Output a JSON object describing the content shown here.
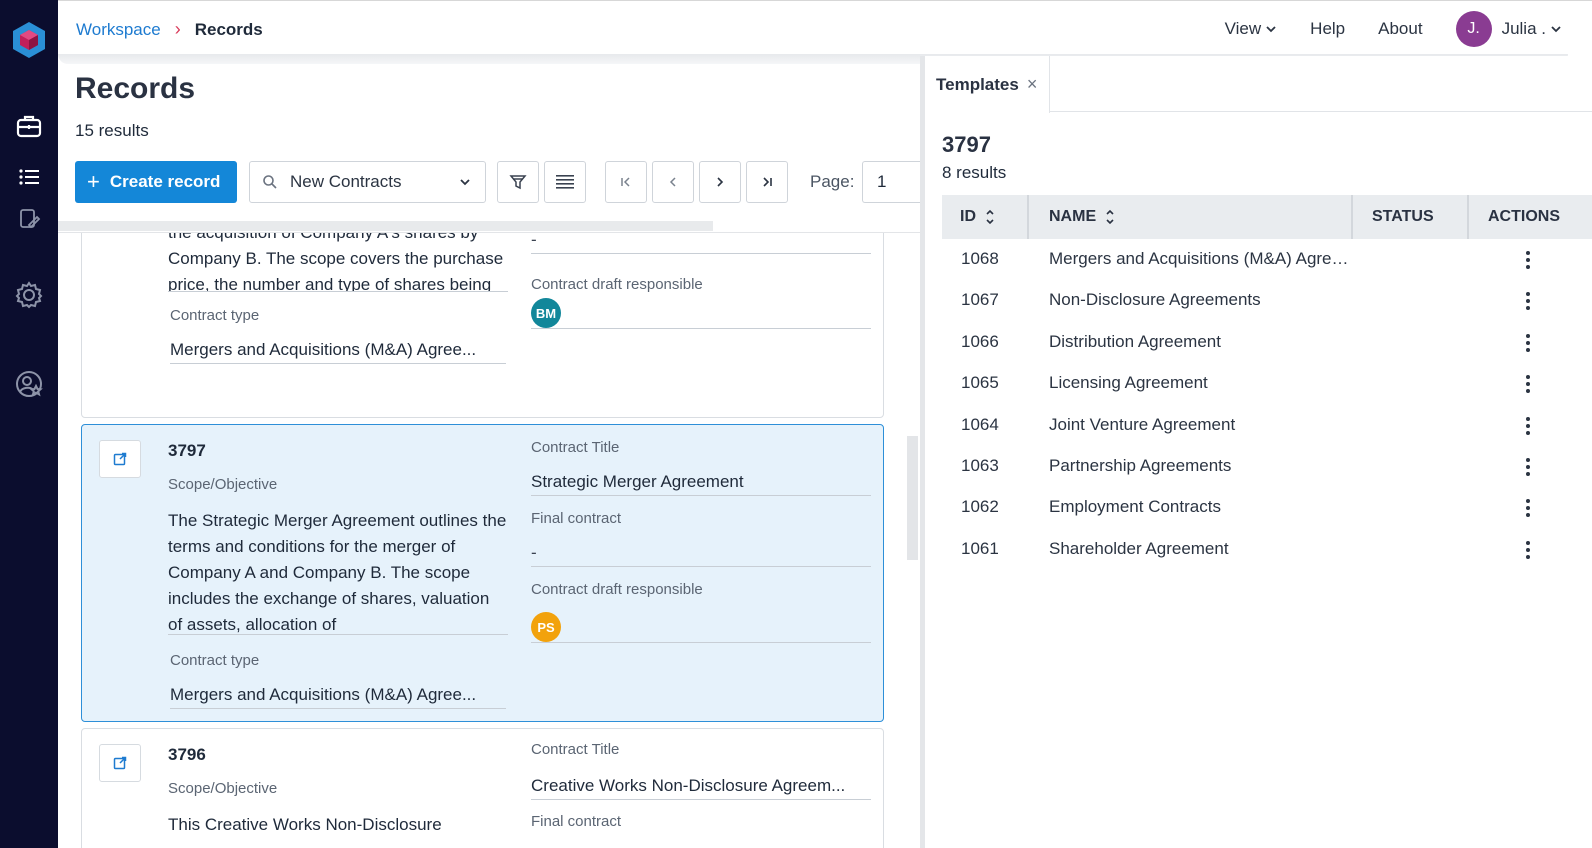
{
  "breadcrumb": {
    "root": "Workspace",
    "separator": "›",
    "current": "Records"
  },
  "topnav": {
    "view": "View",
    "help": "Help",
    "about": "About",
    "user_initial": "J.",
    "user_name": "Julia ."
  },
  "page": {
    "title": "Records",
    "results": "15 results"
  },
  "toolbar": {
    "create_label": "Create record",
    "create_plus": "+",
    "filter_value": "New Contracts",
    "page_label": "Page:",
    "page_value": "1"
  },
  "cards": [
    {
      "scope_text": "the acquisition of Company A's shares by Company B. The scope covers the purchase price, the number and type of shares being acquired, representations",
      "contract_type_label": "Contract type",
      "contract_type": "Mergers and Acquisitions (M&A) Agree...",
      "final_value": "-",
      "responsible_label": "Contract draft responsible",
      "responsible_initials": "BM"
    },
    {
      "id": "3797",
      "scope_label": "Scope/Objective",
      "scope_text": "The Strategic Merger Agreement outlines the terms and conditions for the merger of Company A and Company B. The scope includes the exchange of shares, valuation of assets, allocation of",
      "contract_type_label": "Contract type",
      "contract_type": "Mergers and Acquisitions (M&A) Agree...",
      "title_label": "Contract Title",
      "title_value": "Strategic Merger Agreement",
      "final_label": "Final contract",
      "final_value": "-",
      "responsible_label": "Contract draft responsible",
      "responsible_initials": "PS"
    },
    {
      "id": "3796",
      "scope_label": "Scope/Objective",
      "scope_text": "This Creative Works Non-Disclosure",
      "title_label": "Contract Title",
      "title_value": "Creative Works Non-Disclosure Agreem...",
      "final_label": "Final contract"
    }
  ],
  "templates": {
    "tab_label": "Templates",
    "close": "×",
    "heading": "3797",
    "results": "8 results",
    "columns": [
      "ID",
      "NAME",
      "STATUS",
      "ACTIONS"
    ],
    "rows": [
      {
        "id": "1068",
        "name": "Mergers and Acquisitions (M&A) Agree..."
      },
      {
        "id": "1067",
        "name": "Non-Disclosure Agreements"
      },
      {
        "id": "1066",
        "name": "Distribution Agreement"
      },
      {
        "id": "1065",
        "name": "Licensing Agreement"
      },
      {
        "id": "1064",
        "name": "Joint Venture Agreement"
      },
      {
        "id": "1063",
        "name": "Partnership Agreements"
      },
      {
        "id": "1062",
        "name": "Employment Contracts"
      },
      {
        "id": "1061",
        "name": "Shareholder Agreement"
      }
    ]
  },
  "colors": {
    "accent": "#1487d8",
    "rail": "#0b0d2e",
    "avatar": "#8a3c92",
    "bm": "#12879a",
    "ps": "#f2a20c",
    "selected_bg": "#e6f2fb"
  },
  "icons": [
    "logo-cube-icon",
    "briefcase-icon",
    "list-icon",
    "document-edit-icon",
    "gear-icon",
    "user-star-icon",
    "search-icon",
    "chevron-down-icon",
    "filter-icon",
    "list-view-icon",
    "first-page-icon",
    "prev-page-icon",
    "next-page-icon",
    "last-page-icon",
    "open-external-icon",
    "sort-icon",
    "kebab-menu-icon"
  ]
}
